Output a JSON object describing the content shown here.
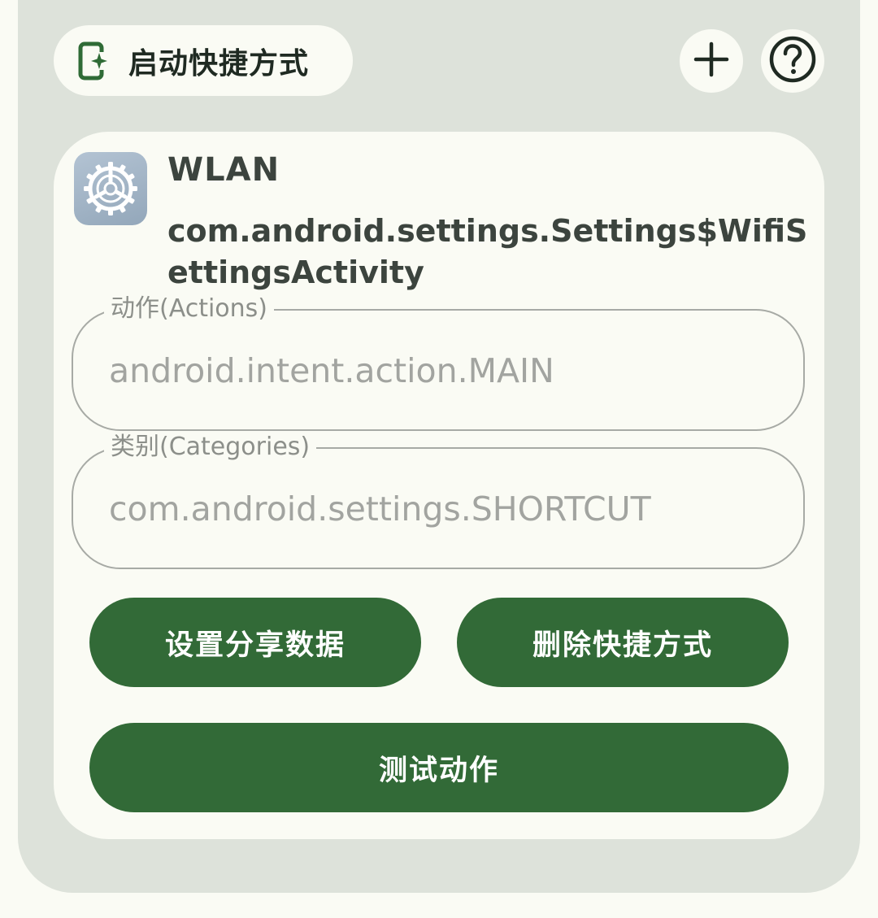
{
  "header": {
    "title": "启动快捷方式",
    "title_icon": "shortcut-launch-icon",
    "add_icon": "plus-icon",
    "help_icon": "help-circle-icon"
  },
  "shortcut": {
    "app_icon": "settings-gear-icon",
    "name": "WLAN",
    "activity": "com.android.settings.Settings$WifiSettingsActivity"
  },
  "actions_field": {
    "label": "动作(Actions)",
    "placeholder": "android.intent.action.MAIN"
  },
  "categories_field": {
    "label": "类别(Categories)",
    "placeholder": "com.android.settings.SHORTCUT"
  },
  "buttons": {
    "share": "设置分享数据",
    "delete": "删除快捷方式",
    "test": "测试动作"
  },
  "colors": {
    "accent": "#326a37",
    "panel": "#dde2da",
    "card": "#fafbf4"
  }
}
